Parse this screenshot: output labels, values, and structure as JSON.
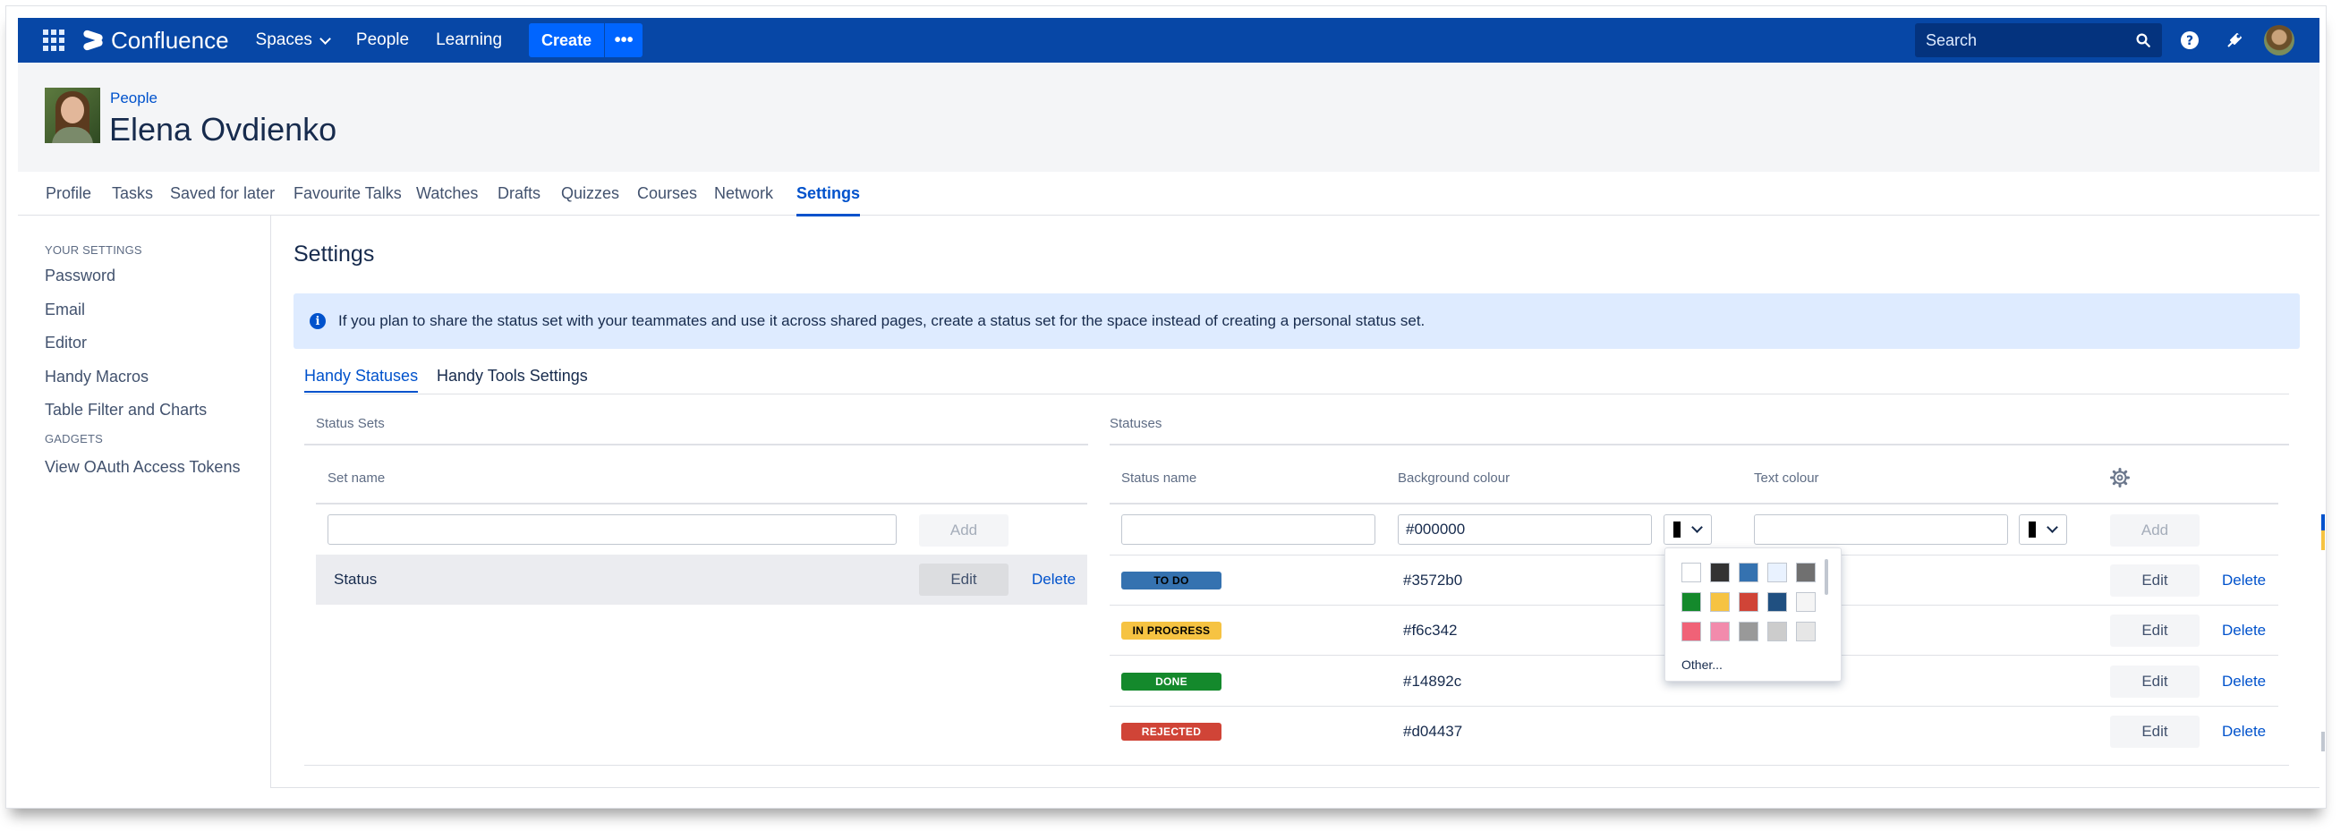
{
  "topnav": {
    "brand": "Confluence",
    "spaces": "Spaces",
    "people": "People",
    "learning": "Learning",
    "create": "Create",
    "more": "•••",
    "search_placeholder": "Search",
    "accent": "#0747a6"
  },
  "profile": {
    "breadcrumb": "People",
    "name": "Elena Ovdienko"
  },
  "profile_tabs": [
    "Profile",
    "Tasks",
    "Saved for later",
    "Favourite Talks",
    "Watches",
    "Drafts",
    "Quizzes",
    "Courses",
    "Network",
    "Settings"
  ],
  "sidebar": {
    "your_settings": "YOUR SETTINGS",
    "items": [
      "Password",
      "Email",
      "Editor",
      "Handy Macros",
      "Table Filter and Charts"
    ],
    "gadgets": "GADGETS",
    "gadget_items": [
      "View OAuth Access Tokens"
    ]
  },
  "main": {
    "title": "Settings",
    "info": "If you plan to share the status set with your teammates and use it across shared pages, create a status set for the space instead of creating a personal status set.",
    "tabs": [
      "Handy Statuses",
      "Handy Tools Settings"
    ]
  },
  "status_sets": {
    "section_label": "Status Sets",
    "column_set_name": "Set name",
    "add": "Add",
    "rows": [
      {
        "name": "Status",
        "edit": "Edit",
        "delete": "Delete"
      }
    ]
  },
  "statuses": {
    "section_label": "Statuses",
    "col_name": "Status name",
    "col_bg": "Background colour",
    "col_text": "Text colour",
    "new_bg_value": "#000000",
    "add": "Add",
    "edit": "Edit",
    "delete": "Delete",
    "rows": [
      {
        "label": "TO DO",
        "bg": "#3572b0",
        "text_color": "#000000"
      },
      {
        "label": "IN PROGRESS",
        "bg": "#f6c342",
        "text_color": "#000000"
      },
      {
        "label": "DONE",
        "bg": "#14892c",
        "text_color": "#ffffff"
      },
      {
        "label": "REJECTED",
        "bg": "#d04437",
        "text_color": "#ffffff"
      }
    ]
  },
  "palette": {
    "colors": [
      "#ffffff",
      "#333333",
      "#3572b0",
      "#e9f2ff",
      "#707070",
      "#14892c",
      "#f6c342",
      "#d04437",
      "#205081",
      "#f5f5f5",
      "#f06277",
      "#f28bac",
      "#999999",
      "#cccccc",
      "#e6e6e6"
    ],
    "other": "Other..."
  }
}
